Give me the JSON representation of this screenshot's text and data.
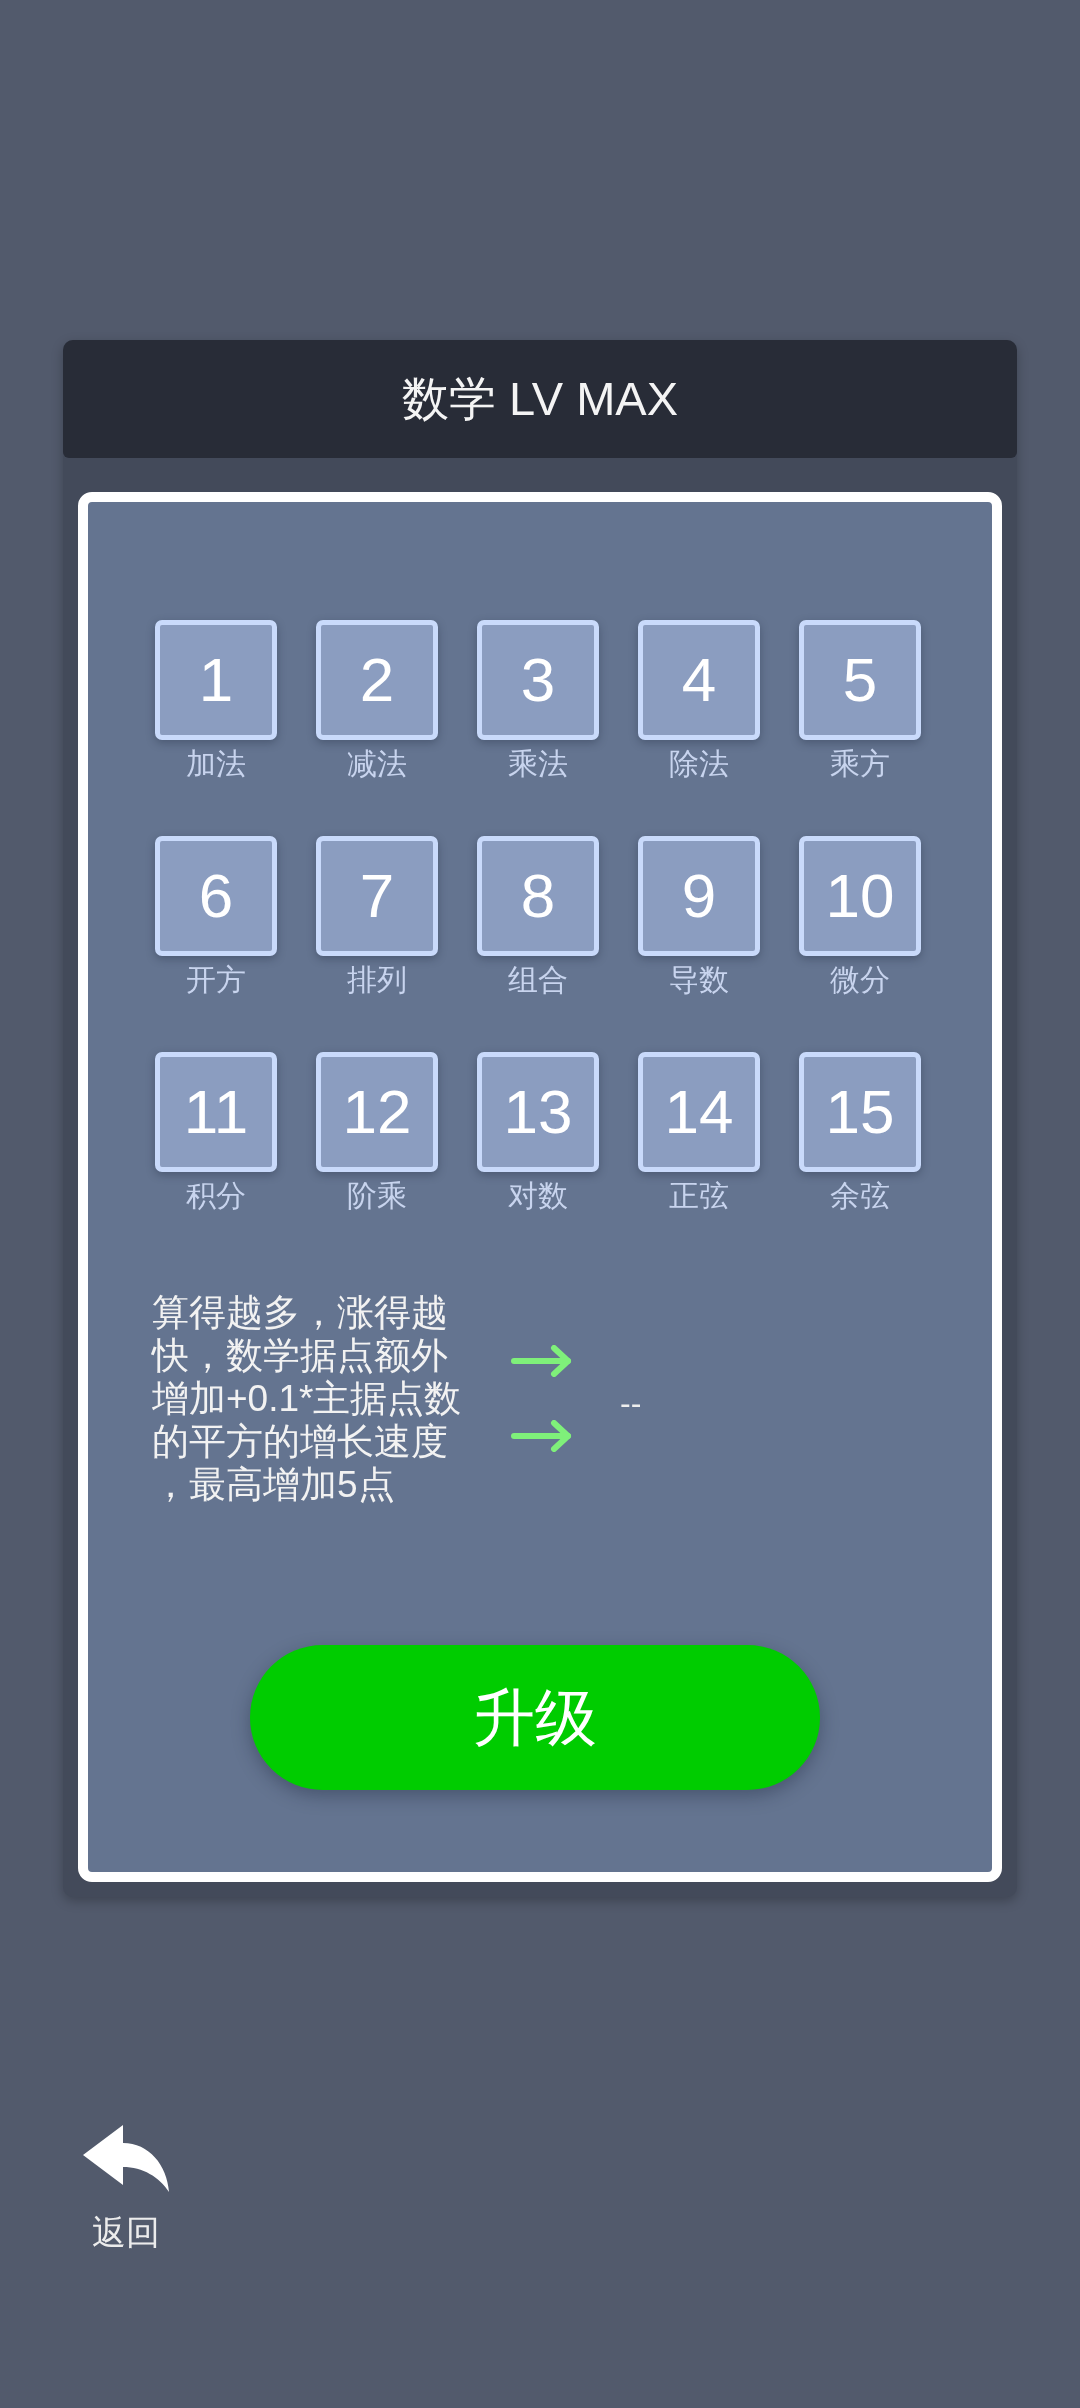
{
  "header": {
    "title": "数学 LV MAX"
  },
  "skills": [
    {
      "number": "1",
      "name": "加法"
    },
    {
      "number": "2",
      "name": "减法"
    },
    {
      "number": "3",
      "name": "乘法"
    },
    {
      "number": "4",
      "name": "除法"
    },
    {
      "number": "5",
      "name": "乘方"
    },
    {
      "number": "6",
      "name": "开方"
    },
    {
      "number": "7",
      "name": "排列"
    },
    {
      "number": "8",
      "name": "组合"
    },
    {
      "number": "9",
      "name": "导数"
    },
    {
      "number": "10",
      "name": "微分"
    },
    {
      "number": "11",
      "name": "积分"
    },
    {
      "number": "12",
      "name": "阶乘"
    },
    {
      "number": "13",
      "name": "对数"
    },
    {
      "number": "14",
      "name": "正弦"
    },
    {
      "number": "15",
      "name": "余弦"
    }
  ],
  "effect": {
    "description": "算得越多，涨得越快，数学据点额外增加+0.1*主据点数的平方的增长速度，最高增加5点",
    "next_value": "--"
  },
  "upgrade_button": {
    "label": "升级"
  },
  "back_button": {
    "label": "返回"
  }
}
